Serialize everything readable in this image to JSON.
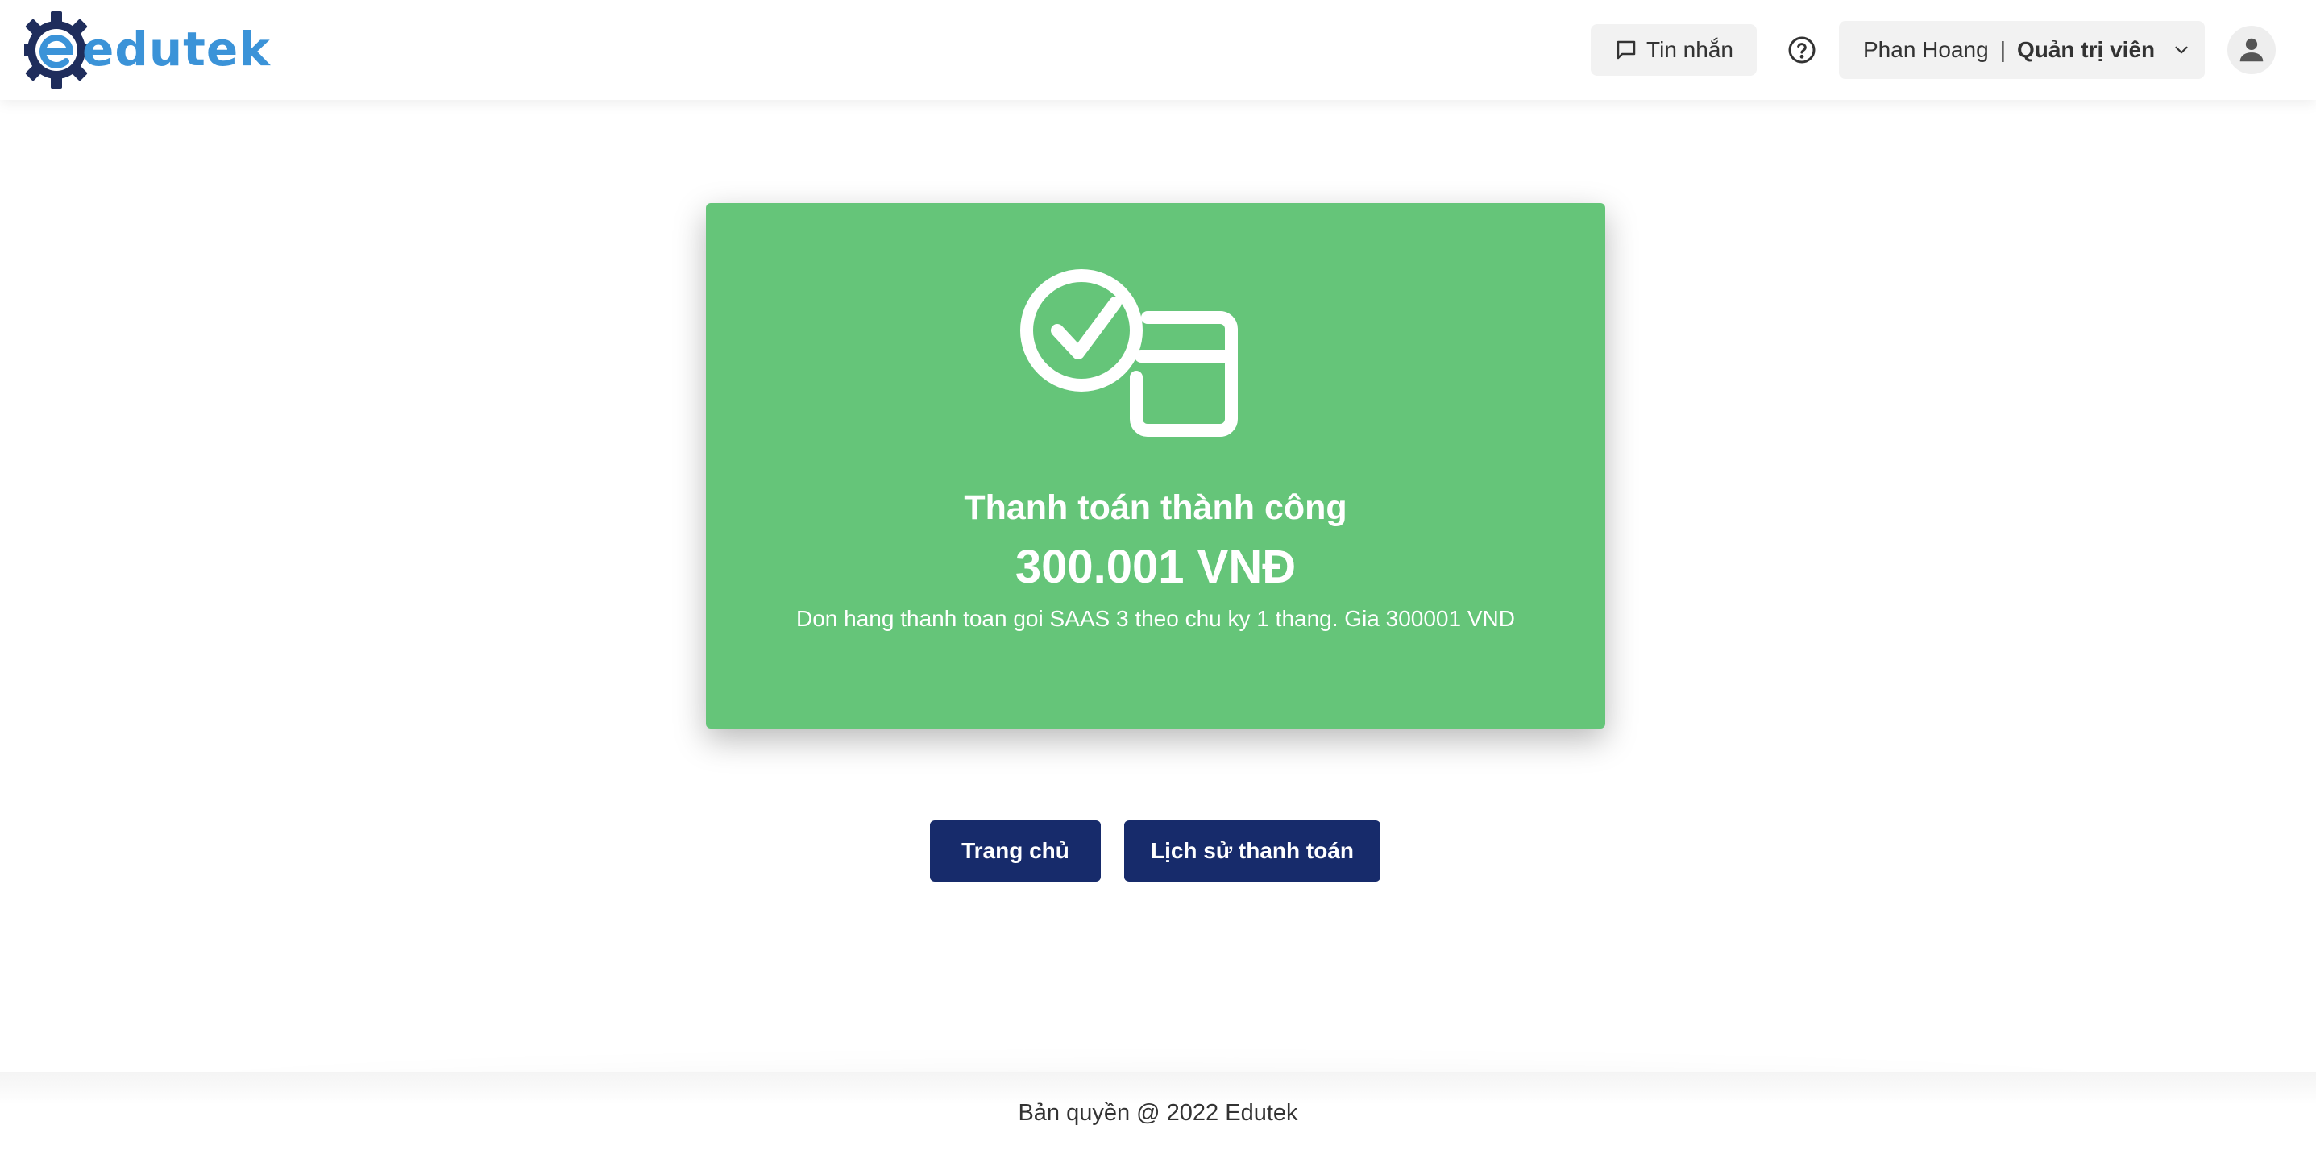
{
  "header": {
    "brand": "edutek",
    "messages_label": "Tin nhắn",
    "user_name": "Phan Hoang",
    "separator": "|",
    "user_role": "Quản trị viên"
  },
  "icons": {
    "logo": "gear-e-logo",
    "messages": "chat-bubble-icon",
    "help": "help-circle-icon",
    "dropdown": "chevron-down-icon",
    "avatar": "person-icon",
    "payment": "card-check-icon"
  },
  "payment": {
    "title": "Thanh toán thành công",
    "amount": "300.001 VNĐ",
    "description": "Don hang thanh toan goi SAAS 3 theo chu ky 1 thang. Gia 300001 VND"
  },
  "actions": {
    "home_label": "Trang chủ",
    "history_label": "Lịch sử thanh toán"
  },
  "footer": {
    "copyright": "Bản quyền @ 2022 Edutek"
  },
  "colors": {
    "brand_blue": "#3b93d8",
    "logo_navy": "#1f2d5c",
    "success_green": "#65c579",
    "button_navy": "#172b6b"
  }
}
